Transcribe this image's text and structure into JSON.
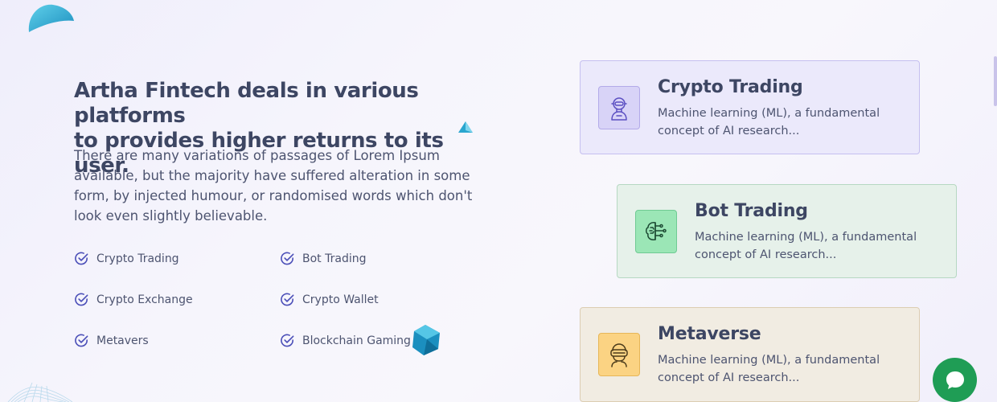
{
  "intro": {
    "heading_line1": "Artha Fintech deals in various platforms",
    "heading_line2": "to provides higher returns to its user.",
    "paragraph": "There are many variations of passages of Lorem Ipsum available, but the majority have suffered alteration in some form, by injected humour, or randomised words which don't look even slightly believable."
  },
  "features": [
    {
      "label": "Crypto Trading"
    },
    {
      "label": "Bot Trading"
    },
    {
      "label": "Crypto Exchange"
    },
    {
      "label": "Crypto Wallet"
    },
    {
      "label": "Metavers"
    },
    {
      "label": "Blockchain Gaming"
    }
  ],
  "cards": [
    {
      "title": "Crypto Trading",
      "description": "Machine learning (ML), a fundamental concept of AI research...",
      "icon": "robot-icon"
    },
    {
      "title": "Bot Trading",
      "description": "Machine learning (ML), a fundamental concept of AI research...",
      "icon": "circuit-brain-icon"
    },
    {
      "title": "Metaverse",
      "description": "Machine learning (ML), a fundamental concept of AI research...",
      "icon": "vr-headset-icon"
    }
  ],
  "chat": {
    "icon": "chat-bubble-icon",
    "color": "#1f9d55"
  },
  "colors": {
    "check": "#4b4fb8",
    "heading": "#3d4663",
    "accent_teal": "#1fa4c9"
  }
}
